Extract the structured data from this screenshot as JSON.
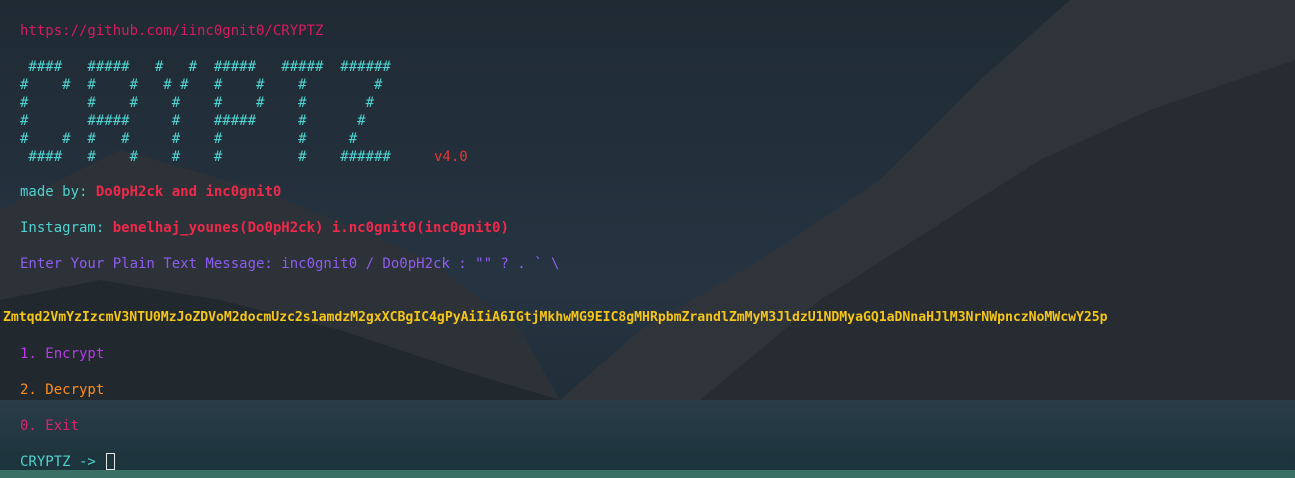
{
  "terminal": {
    "url": "https://github.com/iinc0gnit0/CRYPTZ",
    "ascii_art": [
      " ####   #####   #   #  #####   #####  ######",
      "#    #  #    #   # #   #    #    #        # ",
      "#       #    #    #    #    #    #       #  ",
      "#       #####     #    #####     #      #   ",
      "#    #  #   #     #    #         #     #    ",
      " ####   #    #    #    #         #    ######"
    ],
    "version": "v4.0",
    "made_by_label": "made by:",
    "made_by_value": "Do0pH2ck and inc0gnit0",
    "instagram_label": "Instagram:",
    "instagram_value": "benelhaj_younes(Do0pH2ck) i.nc0gnit0(inc0gnit0)",
    "prompt_message": "Enter Your Plain Text Message: inc0gnit0 / Do0pH2ck : \"\" ? . ` \\",
    "encoded_output": "Zmtqd2VmYzIzcmV3NTU0MzJoZDVoM2docmUzc2s1amdzM2gxXCBgIC4gPyAiIiA6IGtjMkhwMG9EIC8gMHRpbmZrandlZmMyM3JldzU1NDMyaGQ1aDNnaHJlM3NrNWpnczNoMWcwY25p",
    "menu": [
      "1. Encrypt",
      "2. Decrypt",
      "0. Exit"
    ],
    "shell_prompt": "CRYPTZ ->"
  },
  "colors": {
    "url": "#d81b60",
    "art": "#4fd3d0",
    "highlight_red": "#f0294a",
    "prompt_purple": "#8e5cf0",
    "output_yellow": "#f5c518",
    "encrypt": "#b43be6",
    "decrypt": "#ff8c1a",
    "exit": "#e0226e"
  }
}
